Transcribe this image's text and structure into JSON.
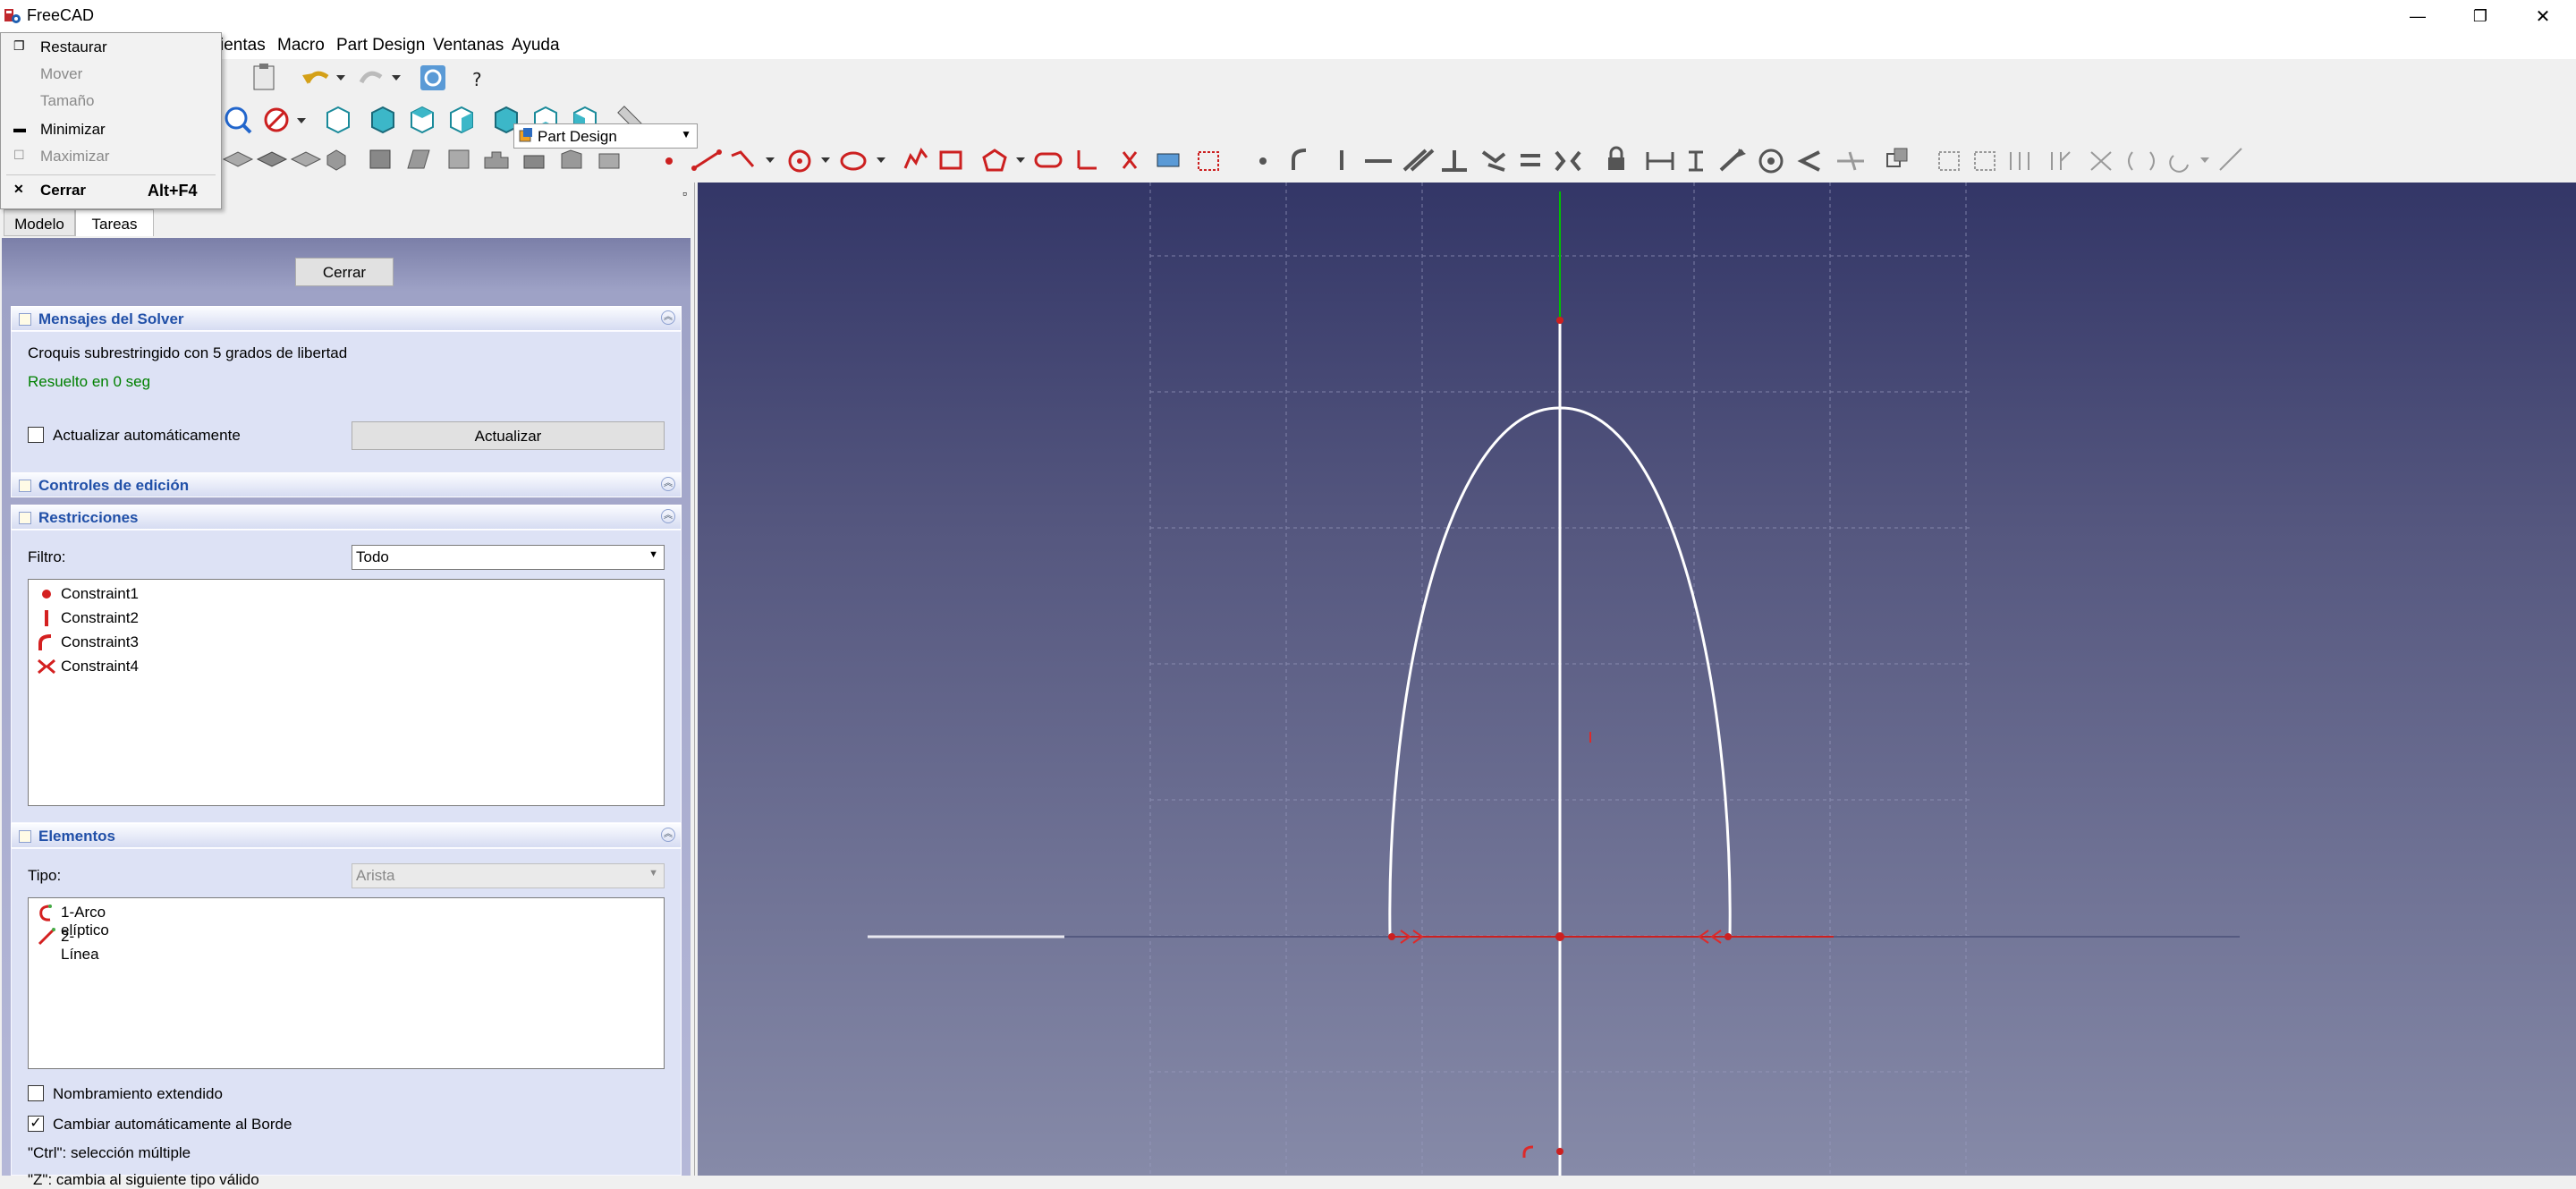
{
  "window": {
    "title": "FreeCAD",
    "minimize_glyph": "—",
    "restore_glyph": "❐",
    "close_glyph": "✕"
  },
  "menubar": {
    "items": [
      "ientas",
      "Macro",
      "Part Design",
      "Ventanas",
      "Ayuda"
    ]
  },
  "system_menu": {
    "items": [
      {
        "label": "Restaurar",
        "icon": "❐",
        "enabled": true
      },
      {
        "label": "Mover",
        "icon": "",
        "enabled": false
      },
      {
        "label": "Tamaño",
        "icon": "",
        "enabled": false
      },
      {
        "label": "Minimizar",
        "icon": "▬",
        "enabled": true
      },
      {
        "label": "Maximizar",
        "icon": "☐",
        "enabled": false
      }
    ],
    "close": {
      "label": "Cerrar",
      "icon": "✕",
      "shortcut": "Alt+F4"
    }
  },
  "toolbar": {
    "workbench": "Part Design"
  },
  "left_panel": {
    "float_glyph": "▫",
    "tabs": [
      "Modelo",
      "Tareas"
    ],
    "active_tab": "Tareas",
    "close_button": "Cerrar",
    "solver": {
      "title": "Mensajes del Solver",
      "message": "Croquis subrestringido con 5 grados de libertad",
      "status": "Resuelto en 0 seg",
      "auto_update_label": "Actualizar automáticamente",
      "auto_update_checked": false,
      "update_button": "Actualizar"
    },
    "edit_controls": {
      "title": "Controles de edición"
    },
    "constraints": {
      "title": "Restricciones",
      "filter_label": "Filtro:",
      "filter_value": "Todo",
      "items": [
        {
          "name": "Constraint1",
          "icon": "point-on-object-icon"
        },
        {
          "name": "Constraint2",
          "icon": "vertical-constraint-icon"
        },
        {
          "name": "Constraint3",
          "icon": "tangent-constraint-icon"
        },
        {
          "name": "Constraint4",
          "icon": "symmetric-constraint-icon"
        }
      ]
    },
    "elements": {
      "title": "Elementos",
      "type_label": "Tipo:",
      "type_value": "Arista",
      "items": [
        {
          "name": "1-Arco elíptico",
          "icon": "elliptical-arc-icon"
        },
        {
          "name": "2-Línea",
          "icon": "line-icon"
        }
      ],
      "extended_naming_label": "Nombramiento extendido",
      "extended_naming_checked": false,
      "auto_switch_label": "Cambiar automáticamente al Borde",
      "auto_switch_checked": true,
      "hint_ctrl": "\"Ctrl\": selección múltiple",
      "hint_z": "\"Z\": cambia al siguiente tipo válido"
    }
  },
  "colors": {
    "accent": "#2150a8",
    "solver_ok": "#008000",
    "constraint_red": "#d42020",
    "axis_green": "#00c000",
    "axis_red": "#cc2020",
    "sketch_white": "#ffffff"
  }
}
